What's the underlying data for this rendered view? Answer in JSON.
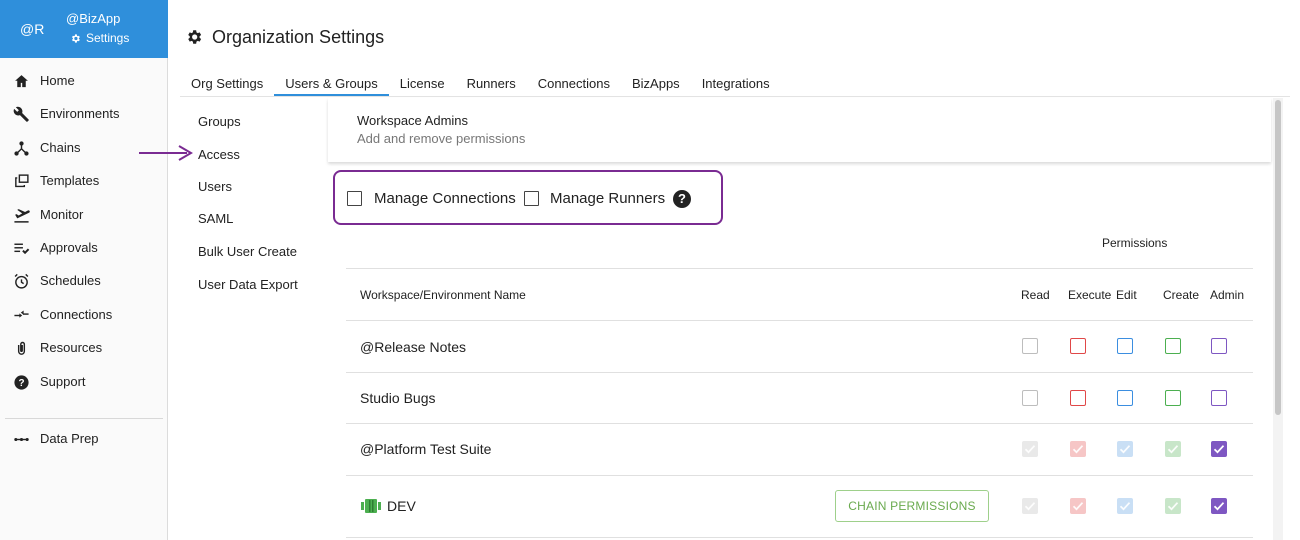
{
  "brand": {
    "avatar": "@R",
    "name": "@BizApp",
    "settings_label": "Settings",
    "color": "#2f8fdb"
  },
  "sidebar": {
    "items": [
      {
        "label": "Home",
        "icon": "home-icon"
      },
      {
        "label": "Environments",
        "icon": "wrench-icon"
      },
      {
        "label": "Chains",
        "icon": "chains-icon"
      },
      {
        "label": "Templates",
        "icon": "templates-icon"
      },
      {
        "label": "Monitor",
        "icon": "monitor-icon"
      },
      {
        "label": "Approvals",
        "icon": "approvals-icon"
      },
      {
        "label": "Schedules",
        "icon": "alarm-clock-icon"
      },
      {
        "label": "Connections",
        "icon": "connections-icon"
      },
      {
        "label": "Resources",
        "icon": "paperclip-icon"
      },
      {
        "label": "Support",
        "icon": "help-circle-icon"
      }
    ],
    "extra": [
      {
        "label": "Data Prep",
        "icon": "dots-icon"
      }
    ]
  },
  "header": {
    "title": "Organization Settings",
    "icon": "gear-icon"
  },
  "tabs": [
    {
      "label": "Org Settings",
      "active": false
    },
    {
      "label": "Users & Groups",
      "active": true
    },
    {
      "label": "License",
      "active": false
    },
    {
      "label": "Runners",
      "active": false
    },
    {
      "label": "Connections",
      "active": false
    },
    {
      "label": "BizApps",
      "active": false
    },
    {
      "label": "Integrations",
      "active": false
    }
  ],
  "subnav": [
    {
      "label": "Groups"
    },
    {
      "label": "Access"
    },
    {
      "label": "Users"
    },
    {
      "label": "SAML"
    },
    {
      "label": "Bulk User Create"
    },
    {
      "label": "User Data Export"
    }
  ],
  "admin_card": {
    "title": "Workspace Admins",
    "subtitle": "Add and remove permissions"
  },
  "global_perms": {
    "manage_connections": {
      "label": "Manage Connections",
      "checked": false
    },
    "manage_runners": {
      "label": "Manage Runners",
      "checked": false
    },
    "help_icon": "?",
    "highlight_color": "#7a2b92"
  },
  "table": {
    "group_header": "Permissions",
    "name_header": "Workspace/Environment Name",
    "columns": [
      {
        "label": "Read",
        "color": "#bdbdbd",
        "fill": "#e9e9e9"
      },
      {
        "label": "Execute",
        "color": "#e04848",
        "fill": "#f6c6c6"
      },
      {
        "label": "Edit",
        "color": "#3b8ee0",
        "fill": "#c9dff5"
      },
      {
        "label": "Create",
        "color": "#4caf50",
        "fill": "#c8e6c9"
      },
      {
        "label": "Admin",
        "color": "#7e57c2",
        "fill": "#7e57c2"
      }
    ],
    "rows": [
      {
        "name": "@Release Notes",
        "checked": [
          false,
          false,
          false,
          false,
          false
        ]
      },
      {
        "name": "Studio Bugs",
        "checked": [
          false,
          false,
          false,
          false,
          false
        ]
      },
      {
        "name": "@Platform Test Suite",
        "checked": [
          true,
          true,
          true,
          true,
          true
        ]
      },
      {
        "name": "DEV",
        "checked": [
          true,
          true,
          true,
          true,
          true
        ],
        "button": "CHAIN PERMISSIONS",
        "icon": "environment-icon"
      }
    ]
  }
}
